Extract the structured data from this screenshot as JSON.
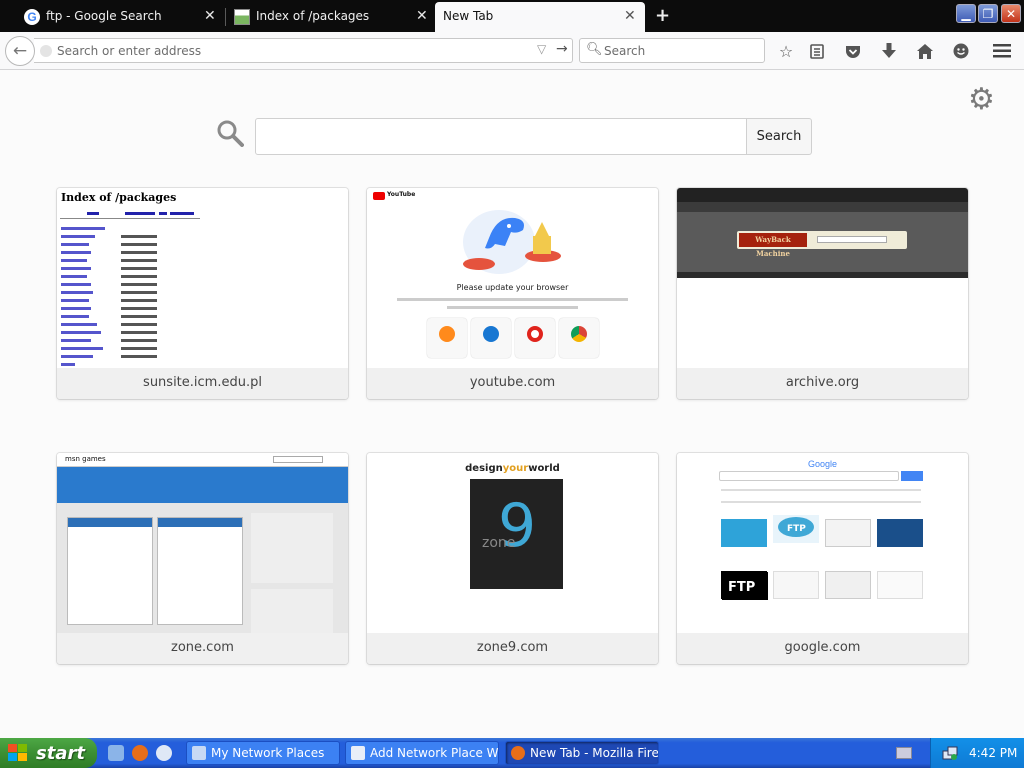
{
  "tabs": [
    {
      "title": "ftp - Google Search",
      "icon": "google-favicon",
      "close": "✕"
    },
    {
      "title": "Index of /packages",
      "icon": "image-favicon",
      "close": "✕"
    },
    {
      "title": "New Tab",
      "icon": "none",
      "close": "✕",
      "active": true
    }
  ],
  "new_tab_glyph": "+",
  "window_controls": {
    "minimize": "▁",
    "restore": "❐",
    "close": "✕"
  },
  "navbar": {
    "url_placeholder": "Search or enter address",
    "url_value": "",
    "search_placeholder": "Search"
  },
  "newtab_page": {
    "search_button": "Search",
    "search_value": "",
    "tiles": [
      {
        "caption": "sunsite.icm.edu.pl",
        "thumb_title": "Index of /packages"
      },
      {
        "caption": "youtube.com",
        "thumb_text": "Please update your browser",
        "thumb_brand": "YouTube"
      },
      {
        "caption": "archive.org",
        "thumb_logo": "WayBack Machine"
      },
      {
        "caption": "zone.com",
        "thumb_brand": "msn games"
      },
      {
        "caption": "zone9.com",
        "thumb_title_a": "design",
        "thumb_title_b": "your",
        "thumb_title_c": "world",
        "thumb_digit": "9",
        "thumb_word": "zone"
      },
      {
        "caption": "google.com",
        "thumb_logo": "Google"
      }
    ]
  },
  "taskbar": {
    "start_label": "start",
    "tasks": [
      {
        "label": "My Network Places"
      },
      {
        "label": "Add Network Place W..."
      },
      {
        "label": "New Tab - Mozilla Fire...",
        "active": true
      }
    ],
    "clock": "4:42 PM"
  },
  "colors": {
    "accent": "#0a84ff",
    "taskbar": "#245edb",
    "start": "#3c8f33"
  }
}
